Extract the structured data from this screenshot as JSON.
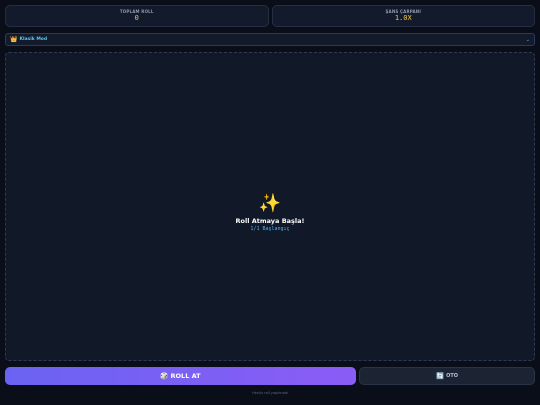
{
  "stats": [
    {
      "label": "TOPLAM ROLL",
      "value": "0"
    },
    {
      "label": "ŞANS ÇARPANI",
      "value": "1.0X"
    }
  ],
  "mode": {
    "icon": "crown-icon",
    "label": "Klasik Mod",
    "chevron": "⌄"
  },
  "arena": {
    "icon": "✨",
    "title": "Roll Atmaya Başla!",
    "subtitle": "1/1 Başlangıç"
  },
  "buttons": {
    "roll": {
      "icon": "🎲",
      "label": "ROLL AT"
    },
    "auto": {
      "icon": "🔄",
      "label": "OTO"
    }
  },
  "footer": {
    "text": "Henüz roll yapılmadı"
  },
  "colors": {
    "accent_gold": "#f5c842",
    "accent_cyan": "#5ec8f2",
    "roll_gradient_start": "#6a63f2",
    "roll_gradient_end": "#8b5cf6",
    "background": "#0a0e18"
  }
}
